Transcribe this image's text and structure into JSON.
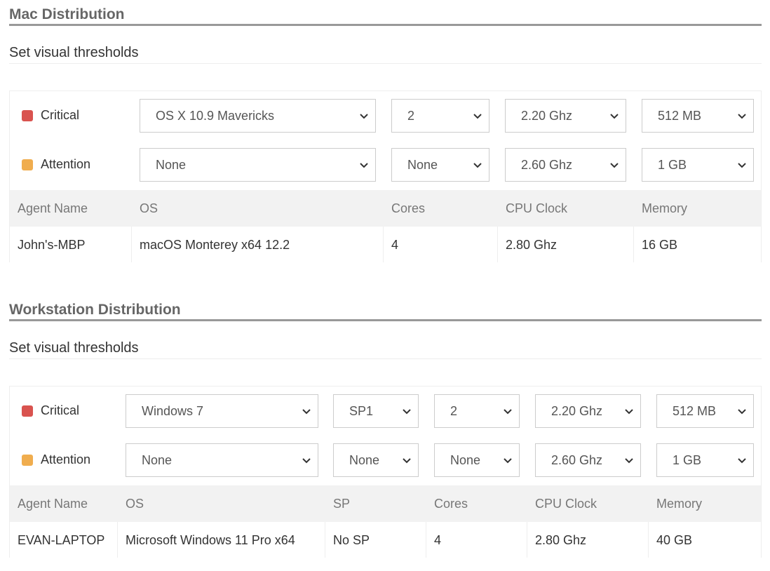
{
  "mac": {
    "title": "Mac Distribution",
    "subtitle": "Set visual thresholds",
    "critical": {
      "label": "Critical",
      "color": "#d9534f",
      "os": "OS X 10.9 Mavericks",
      "cores": "2",
      "cpu": "2.20 Ghz",
      "memory": "512 MB"
    },
    "attention": {
      "label": "Attention",
      "color": "#f0ad4e",
      "os": "None",
      "cores": "None",
      "cpu": "2.60 Ghz",
      "memory": "1 GB"
    },
    "columns": [
      "Agent Name",
      "OS",
      "Cores",
      "CPU Clock",
      "Memory"
    ],
    "rows": [
      [
        "John's-MBP",
        "macOS Monterey x64 12.2",
        "4",
        "2.80 Ghz",
        "16 GB"
      ]
    ]
  },
  "workstation": {
    "title": "Workstation Distribution",
    "subtitle": "Set visual thresholds",
    "critical": {
      "label": "Critical",
      "color": "#d9534f",
      "os": "Windows 7",
      "sp": "SP1",
      "cores": "2",
      "cpu": "2.20 Ghz",
      "memory": "512 MB"
    },
    "attention": {
      "label": "Attention",
      "color": "#f0ad4e",
      "os": "None",
      "sp": "None",
      "cores": "None",
      "cpu": "2.60 Ghz",
      "memory": "1 GB"
    },
    "columns": [
      "Agent Name",
      "OS",
      "SP",
      "Cores",
      "CPU Clock",
      "Memory"
    ],
    "rows": [
      [
        "EVAN-LAPTOP",
        "Microsoft Windows 11 Pro x64",
        "No SP",
        "4",
        "2.80 Ghz",
        "40 GB"
      ]
    ]
  },
  "icons": {
    "dropdown": "chevron-down-icon"
  }
}
